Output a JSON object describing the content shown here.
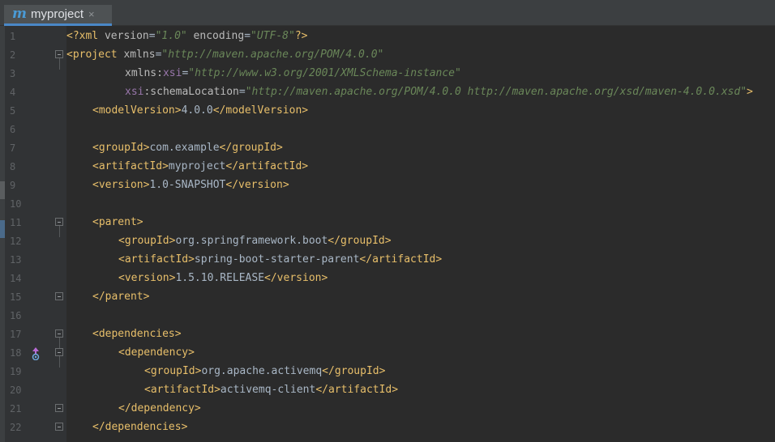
{
  "tab": {
    "logo": "m",
    "title": "myproject",
    "close": "×"
  },
  "lines": [
    {
      "n": "1",
      "indent": 0,
      "fold": "",
      "segs": [
        {
          "t": "<?xml ",
          "c": "tag"
        },
        {
          "t": "version",
          "c": "attr"
        },
        {
          "t": "=",
          "c": "txt"
        },
        {
          "t": "\"1.0\"",
          "c": "str"
        },
        {
          "t": " encoding",
          "c": "attr"
        },
        {
          "t": "=",
          "c": "txt"
        },
        {
          "t": "\"UTF-8\"",
          "c": "str"
        },
        {
          "t": "?>",
          "c": "tag"
        }
      ]
    },
    {
      "n": "2",
      "indent": 0,
      "fold": "top",
      "segs": [
        {
          "t": "<project ",
          "c": "tag"
        },
        {
          "t": "xmlns",
          "c": "attr"
        },
        {
          "t": "=",
          "c": "txt"
        },
        {
          "t": "\"http://maven.apache.org/POM/4.0.0\"",
          "c": "str"
        }
      ]
    },
    {
      "n": "3",
      "indent": 9,
      "fold": "",
      "segs": [
        {
          "t": "xmlns:",
          "c": "attr"
        },
        {
          "t": "xsi",
          "c": "ns"
        },
        {
          "t": "=",
          "c": "txt"
        },
        {
          "t": "\"http://www.w3.org/2001/XMLSchema-instance\"",
          "c": "str"
        }
      ]
    },
    {
      "n": "4",
      "indent": 9,
      "fold": "",
      "segs": [
        {
          "t": "xsi",
          "c": "ns"
        },
        {
          "t": ":schemaLocation",
          "c": "attr"
        },
        {
          "t": "=",
          "c": "txt"
        },
        {
          "t": "\"http://maven.apache.org/POM/4.0.0 http://maven.apache.org/xsd/maven-4.0.0.xsd\"",
          "c": "str"
        },
        {
          "t": ">",
          "c": "tag"
        }
      ]
    },
    {
      "n": "5",
      "indent": 4,
      "fold": "",
      "segs": [
        {
          "t": "<modelVersion>",
          "c": "tag"
        },
        {
          "t": "4.0.0",
          "c": "txt"
        },
        {
          "t": "</modelVersion>",
          "c": "tag"
        }
      ]
    },
    {
      "n": "6",
      "indent": 0,
      "fold": "",
      "segs": []
    },
    {
      "n": "7",
      "indent": 4,
      "fold": "",
      "segs": [
        {
          "t": "<groupId>",
          "c": "tag"
        },
        {
          "t": "com.example",
          "c": "txt"
        },
        {
          "t": "</groupId>",
          "c": "tag"
        }
      ]
    },
    {
      "n": "8",
      "indent": 4,
      "fold": "",
      "segs": [
        {
          "t": "<artifactId>",
          "c": "tag"
        },
        {
          "t": "myproject",
          "c": "txt"
        },
        {
          "t": "</artifactId>",
          "c": "tag"
        }
      ]
    },
    {
      "n": "9",
      "indent": 4,
      "fold": "",
      "segs": [
        {
          "t": "<version>",
          "c": "tag"
        },
        {
          "t": "1.0-SNAPSHOT",
          "c": "txt"
        },
        {
          "t": "</version>",
          "c": "tag"
        }
      ]
    },
    {
      "n": "10",
      "indent": 0,
      "fold": "",
      "segs": []
    },
    {
      "n": "11",
      "indent": 4,
      "fold": "top",
      "segs": [
        {
          "t": "<parent>",
          "c": "tag"
        }
      ]
    },
    {
      "n": "12",
      "indent": 8,
      "fold": "",
      "segs": [
        {
          "t": "<groupId>",
          "c": "tag"
        },
        {
          "t": "org.springframework.boot",
          "c": "txt"
        },
        {
          "t": "</groupId>",
          "c": "tag"
        }
      ]
    },
    {
      "n": "13",
      "indent": 8,
      "fold": "",
      "segs": [
        {
          "t": "<artifactId>",
          "c": "tag"
        },
        {
          "t": "spring-boot-starter-parent",
          "c": "txt"
        },
        {
          "t": "</artifactId>",
          "c": "tag"
        }
      ]
    },
    {
      "n": "14",
      "indent": 8,
      "fold": "",
      "segs": [
        {
          "t": "<version>",
          "c": "tag"
        },
        {
          "t": "1.5.10.RELEASE",
          "c": "txt"
        },
        {
          "t": "</version>",
          "c": "tag"
        }
      ]
    },
    {
      "n": "15",
      "indent": 4,
      "fold": "end",
      "segs": [
        {
          "t": "</parent>",
          "c": "tag"
        }
      ]
    },
    {
      "n": "16",
      "indent": 0,
      "fold": "",
      "segs": []
    },
    {
      "n": "17",
      "indent": 4,
      "fold": "top",
      "segs": [
        {
          "t": "<dependencies>",
          "c": "tag"
        }
      ]
    },
    {
      "n": "18",
      "indent": 8,
      "fold": "top",
      "icon": "maven-dependency-icon",
      "segs": [
        {
          "t": "<dependency>",
          "c": "tag"
        }
      ]
    },
    {
      "n": "19",
      "indent": 12,
      "fold": "",
      "segs": [
        {
          "t": "<groupId>",
          "c": "tag"
        },
        {
          "t": "org.apache.activemq",
          "c": "txt"
        },
        {
          "t": "</groupId>",
          "c": "tag"
        }
      ]
    },
    {
      "n": "20",
      "indent": 12,
      "fold": "",
      "segs": [
        {
          "t": "<artifactId>",
          "c": "tag"
        },
        {
          "t": "activemq-client",
          "c": "txt"
        },
        {
          "t": "</artifactId>",
          "c": "tag"
        }
      ]
    },
    {
      "n": "21",
      "indent": 8,
      "fold": "end",
      "segs": [
        {
          "t": "</dependency>",
          "c": "tag"
        }
      ]
    },
    {
      "n": "22",
      "indent": 4,
      "fold": "end",
      "segs": [
        {
          "t": "</dependencies>",
          "c": "tag"
        }
      ]
    }
  ],
  "colors": {
    "tag": "#e8bf6a",
    "attr": "#bababa",
    "ns": "#9876aa",
    "string": "#6a8759",
    "text": "#a9b7c6",
    "background": "#2b2b2b"
  }
}
